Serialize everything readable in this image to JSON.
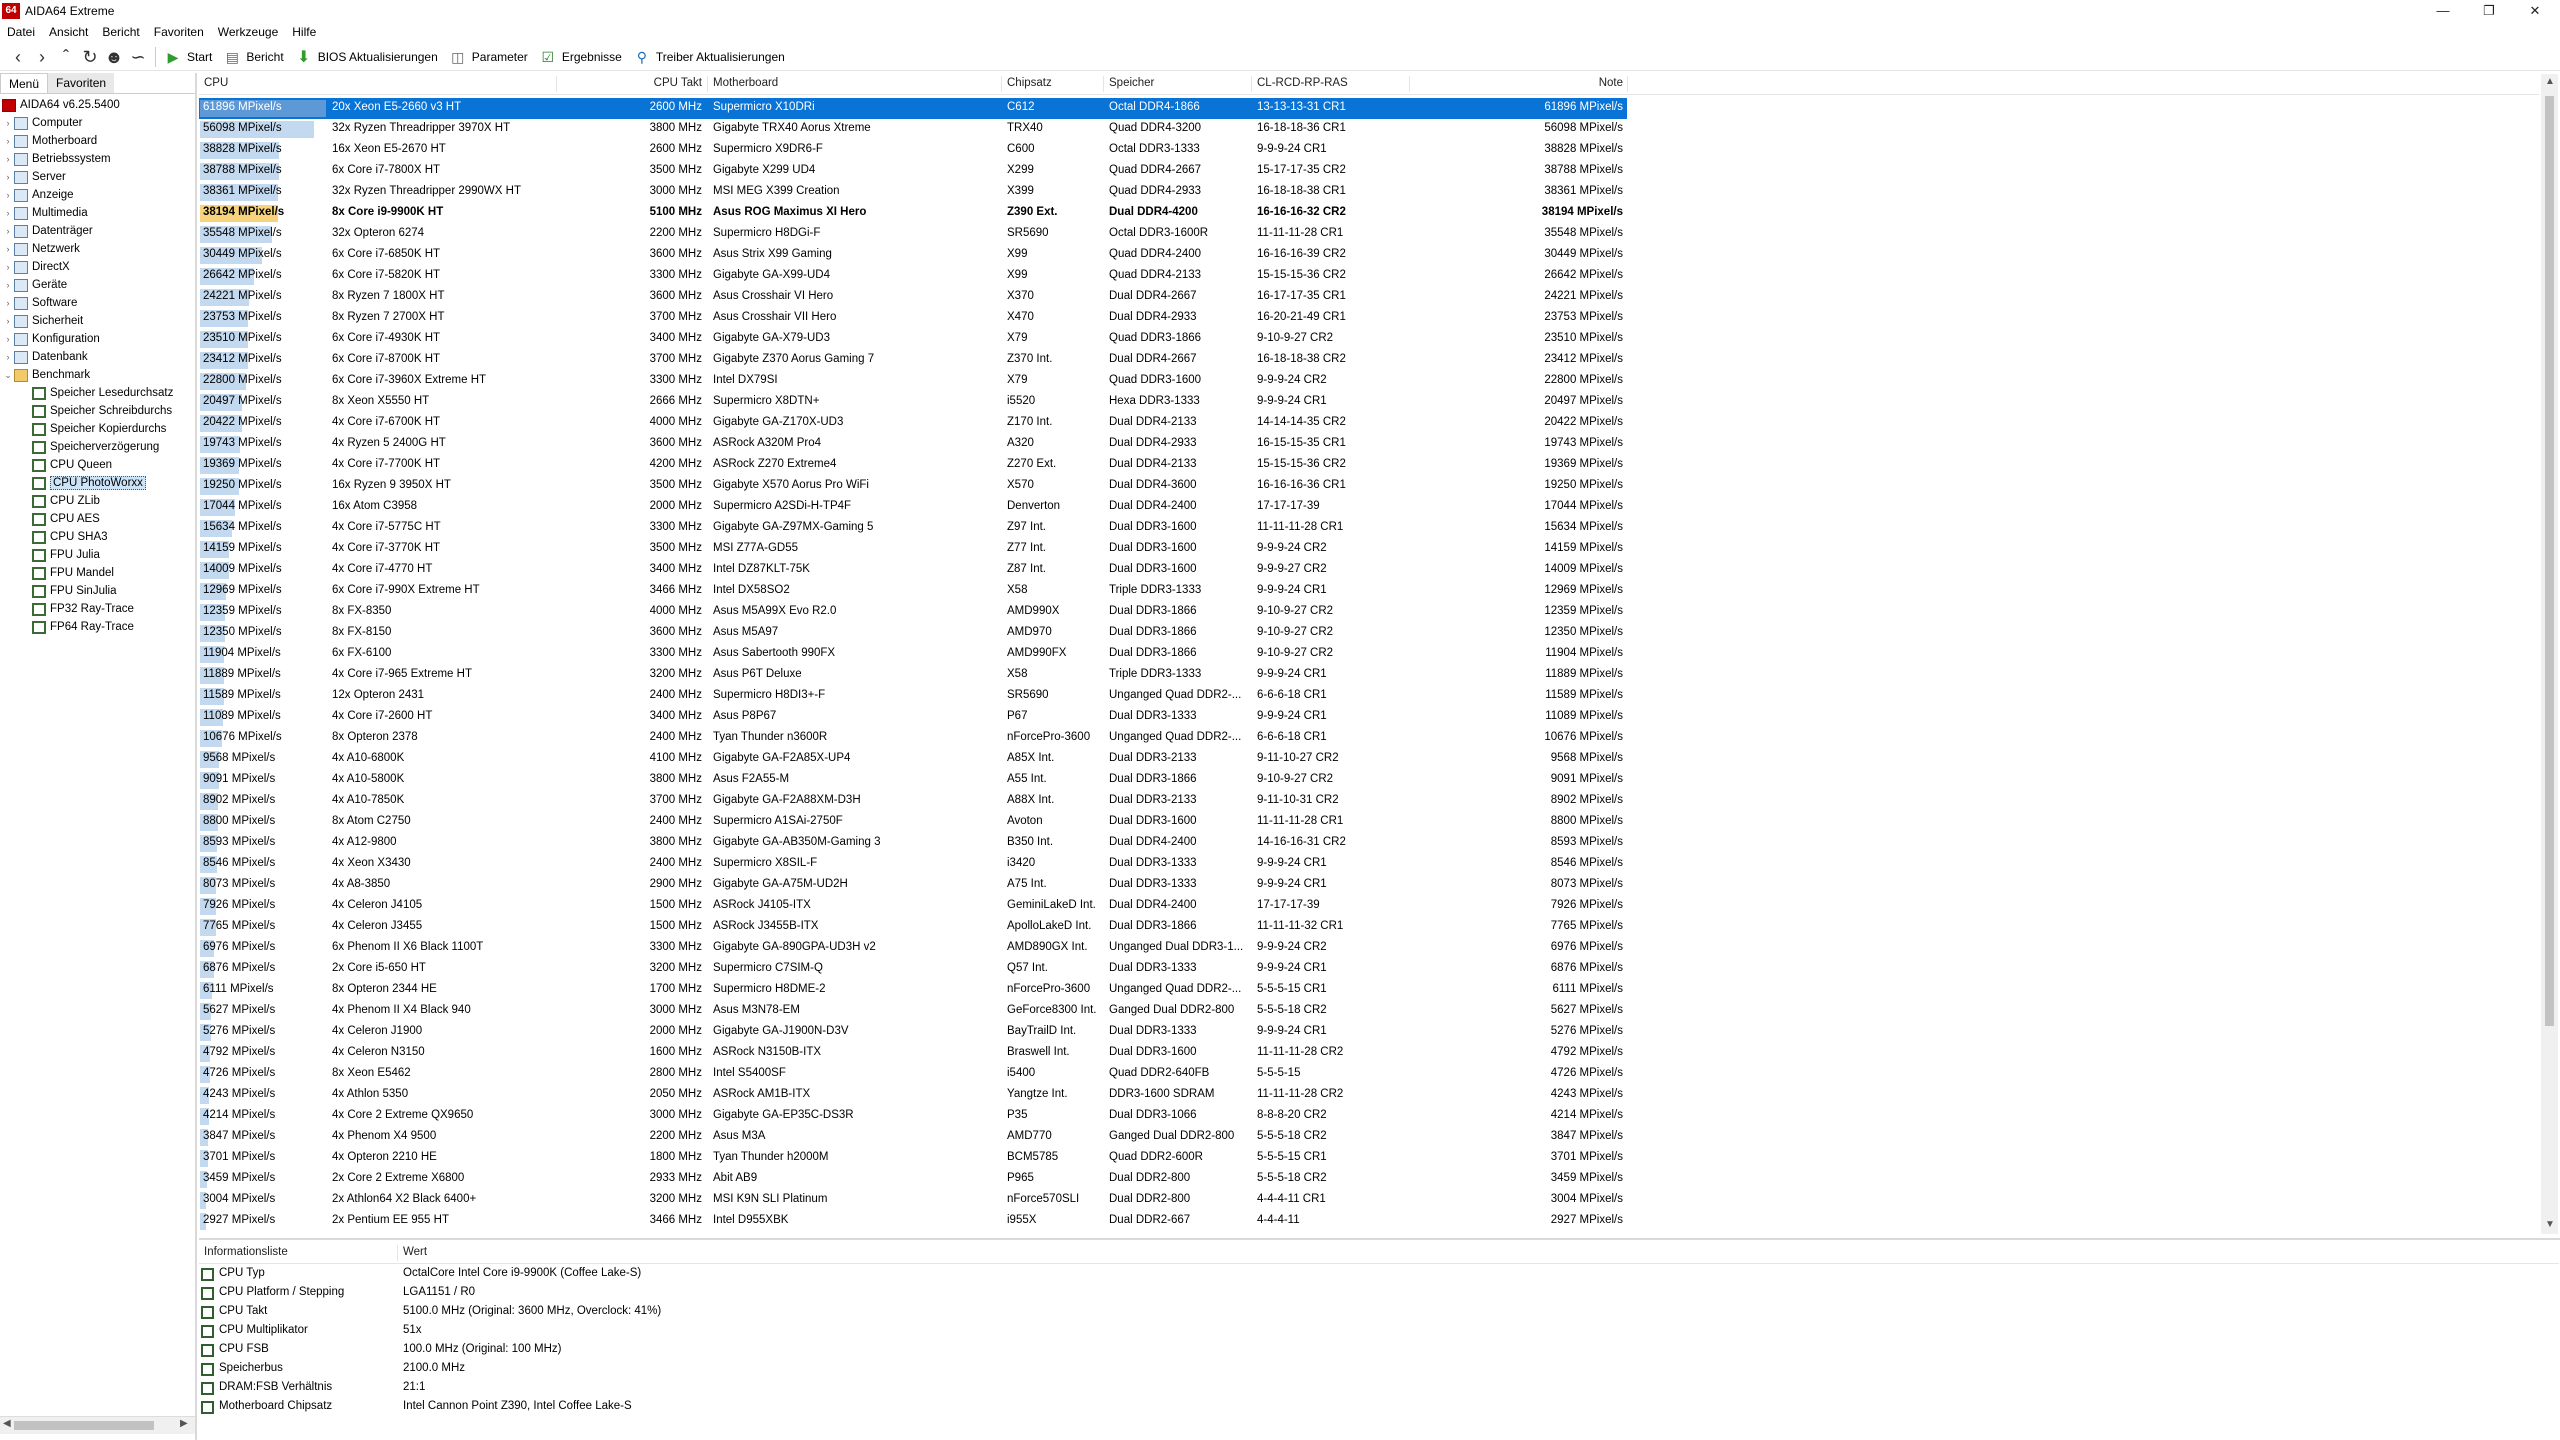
{
  "window": {
    "title": "AIDA64 Extreme",
    "icon_text": "64"
  },
  "menu": [
    "Datei",
    "Ansicht",
    "Bericht",
    "Favoriten",
    "Werkzeuge",
    "Hilfe"
  ],
  "toolbar": {
    "start": "Start",
    "bericht": "Bericht",
    "bios": "BIOS Aktualisierungen",
    "parameter": "Parameter",
    "ergebnisse": "Ergebnisse",
    "treiber": "Treiber Aktualisierungen"
  },
  "left_tabs": {
    "menu": "Menü",
    "favoriten": "Favoriten"
  },
  "tree": [
    {
      "label": "AIDA64 v6.25.5400",
      "level": 0,
      "kind": "root"
    },
    {
      "label": "Computer",
      "level": 1,
      "kind": "cat"
    },
    {
      "label": "Motherboard",
      "level": 1,
      "kind": "cat"
    },
    {
      "label": "Betriebssystem",
      "level": 1,
      "kind": "cat"
    },
    {
      "label": "Server",
      "level": 1,
      "kind": "cat"
    },
    {
      "label": "Anzeige",
      "level": 1,
      "kind": "cat"
    },
    {
      "label": "Multimedia",
      "level": 1,
      "kind": "cat"
    },
    {
      "label": "Datenträger",
      "level": 1,
      "kind": "cat"
    },
    {
      "label": "Netzwerk",
      "level": 1,
      "kind": "cat"
    },
    {
      "label": "DirectX",
      "level": 1,
      "kind": "cat"
    },
    {
      "label": "Geräte",
      "level": 1,
      "kind": "cat"
    },
    {
      "label": "Software",
      "level": 1,
      "kind": "cat"
    },
    {
      "label": "Sicherheit",
      "level": 1,
      "kind": "cat"
    },
    {
      "label": "Konfiguration",
      "level": 1,
      "kind": "cat"
    },
    {
      "label": "Datenbank",
      "level": 1,
      "kind": "cat"
    },
    {
      "label": "Benchmark",
      "level": 1,
      "kind": "folder",
      "expanded": true
    },
    {
      "label": "Speicher Lesedurchsatz",
      "level": 2,
      "kind": "bench"
    },
    {
      "label": "Speicher Schreibdurchs",
      "level": 2,
      "kind": "bench"
    },
    {
      "label": "Speicher Kopierdurchs",
      "level": 2,
      "kind": "bench"
    },
    {
      "label": "Speicherverzögerung",
      "level": 2,
      "kind": "bench"
    },
    {
      "label": "CPU Queen",
      "level": 2,
      "kind": "bench"
    },
    {
      "label": "CPU PhotoWorxx",
      "level": 2,
      "kind": "bench",
      "selected": true
    },
    {
      "label": "CPU ZLib",
      "level": 2,
      "kind": "bench"
    },
    {
      "label": "CPU AES",
      "level": 2,
      "kind": "bench"
    },
    {
      "label": "CPU SHA3",
      "level": 2,
      "kind": "bench"
    },
    {
      "label": "FPU Julia",
      "level": 2,
      "kind": "bench"
    },
    {
      "label": "FPU Mandel",
      "level": 2,
      "kind": "bench"
    },
    {
      "label": "FPU SinJulia",
      "level": 2,
      "kind": "bench"
    },
    {
      "label": "FP32 Ray-Trace",
      "level": 2,
      "kind": "bench"
    },
    {
      "label": "FP64 Ray-Trace",
      "level": 2,
      "kind": "bench"
    }
  ],
  "columns": {
    "cpu": "CPU",
    "clock": "CPU Takt",
    "motherboard": "Motherboard",
    "chipset": "Chipsatz",
    "memory": "Speicher",
    "timings": "CL-RCD-RP-RAS",
    "note": "Note"
  },
  "results_max": 61896,
  "results": [
    {
      "value": "61896 MPixel/s",
      "score": 61896,
      "cpu": "20x Xeon E5-2660 v3 HT",
      "clock": "2600 MHz",
      "mb": "Supermicro X10DRi",
      "chip": "C612",
      "mem": "Octal DDR4-1866",
      "tim": "13-13-13-31 CR1",
      "note": "61896 MPixel/s",
      "selected": true
    },
    {
      "value": "56098 MPixel/s",
      "score": 56098,
      "cpu": "32x Ryzen Threadripper 3970X HT",
      "clock": "3800 MHz",
      "mb": "Gigabyte TRX40 Aorus Xtreme",
      "chip": "TRX40",
      "mem": "Quad DDR4-3200",
      "tim": "16-18-18-36 CR1",
      "note": "56098 MPixel/s"
    },
    {
      "value": "38828 MPixel/s",
      "score": 38828,
      "cpu": "16x Xeon E5-2670 HT",
      "clock": "2600 MHz",
      "mb": "Supermicro X9DR6-F",
      "chip": "C600",
      "mem": "Octal DDR3-1333",
      "tim": "9-9-9-24 CR1",
      "note": "38828 MPixel/s"
    },
    {
      "value": "38788 MPixel/s",
      "score": 38788,
      "cpu": "6x Core i7-7800X HT",
      "clock": "3500 MHz",
      "mb": "Gigabyte X299 UD4",
      "chip": "X299",
      "mem": "Quad DDR4-2667",
      "tim": "15-17-17-35 CR2",
      "note": "38788 MPixel/s"
    },
    {
      "value": "38361 MPixel/s",
      "score": 38361,
      "cpu": "32x Ryzen Threadripper 2990WX HT",
      "clock": "3000 MHz",
      "mb": "MSI MEG X399 Creation",
      "chip": "X399",
      "mem": "Quad DDR4-2933",
      "tim": "16-18-18-38 CR1",
      "note": "38361 MPixel/s"
    },
    {
      "value": "38194 MPixel/s",
      "score": 38194,
      "cpu": "8x Core i9-9900K HT",
      "clock": "5100 MHz",
      "mb": "Asus ROG Maximus XI Hero",
      "chip": "Z390 Ext.",
      "mem": "Dual DDR4-4200",
      "tim": "16-16-16-32 CR2",
      "note": "38194 MPixel/s",
      "own": true
    },
    {
      "value": "35548 MPixel/s",
      "score": 35548,
      "cpu": "32x Opteron 6274",
      "clock": "2200 MHz",
      "mb": "Supermicro H8DGi-F",
      "chip": "SR5690",
      "mem": "Octal DDR3-1600R",
      "tim": "11-11-11-28 CR1",
      "note": "35548 MPixel/s"
    },
    {
      "value": "30449 MPixel/s",
      "score": 30449,
      "cpu": "6x Core i7-6850K HT",
      "clock": "3600 MHz",
      "mb": "Asus Strix X99 Gaming",
      "chip": "X99",
      "mem": "Quad DDR4-2400",
      "tim": "16-16-16-39 CR2",
      "note": "30449 MPixel/s"
    },
    {
      "value": "26642 MPixel/s",
      "score": 26642,
      "cpu": "6x Core i7-5820K HT",
      "clock": "3300 MHz",
      "mb": "Gigabyte GA-X99-UD4",
      "chip": "X99",
      "mem": "Quad DDR4-2133",
      "tim": "15-15-15-36 CR2",
      "note": "26642 MPixel/s"
    },
    {
      "value": "24221 MPixel/s",
      "score": 24221,
      "cpu": "8x Ryzen 7 1800X HT",
      "clock": "3600 MHz",
      "mb": "Asus Crosshair VI Hero",
      "chip": "X370",
      "mem": "Dual DDR4-2667",
      "tim": "16-17-17-35 CR1",
      "note": "24221 MPixel/s"
    },
    {
      "value": "23753 MPixel/s",
      "score": 23753,
      "cpu": "8x Ryzen 7 2700X HT",
      "clock": "3700 MHz",
      "mb": "Asus Crosshair VII Hero",
      "chip": "X470",
      "mem": "Dual DDR4-2933",
      "tim": "16-20-21-49 CR1",
      "note": "23753 MPixel/s"
    },
    {
      "value": "23510 MPixel/s",
      "score": 23510,
      "cpu": "6x Core i7-4930K HT",
      "clock": "3400 MHz",
      "mb": "Gigabyte GA-X79-UD3",
      "chip": "X79",
      "mem": "Quad DDR3-1866",
      "tim": "9-10-9-27 CR2",
      "note": "23510 MPixel/s"
    },
    {
      "value": "23412 MPixel/s",
      "score": 23412,
      "cpu": "6x Core i7-8700K HT",
      "clock": "3700 MHz",
      "mb": "Gigabyte Z370 Aorus Gaming 7",
      "chip": "Z370 Int.",
      "mem": "Dual DDR4-2667",
      "tim": "16-18-18-38 CR2",
      "note": "23412 MPixel/s"
    },
    {
      "value": "22800 MPixel/s",
      "score": 22800,
      "cpu": "6x Core i7-3960X Extreme HT",
      "clock": "3300 MHz",
      "mb": "Intel DX79SI",
      "chip": "X79",
      "mem": "Quad DDR3-1600",
      "tim": "9-9-9-24 CR2",
      "note": "22800 MPixel/s"
    },
    {
      "value": "20497 MPixel/s",
      "score": 20497,
      "cpu": "8x Xeon X5550 HT",
      "clock": "2666 MHz",
      "mb": "Supermicro X8DTN+",
      "chip": "i5520",
      "mem": "Hexa DDR3-1333",
      "tim": "9-9-9-24 CR1",
      "note": "20497 MPixel/s"
    },
    {
      "value": "20422 MPixel/s",
      "score": 20422,
      "cpu": "4x Core i7-6700K HT",
      "clock": "4000 MHz",
      "mb": "Gigabyte GA-Z170X-UD3",
      "chip": "Z170 Int.",
      "mem": "Dual DDR4-2133",
      "tim": "14-14-14-35 CR2",
      "note": "20422 MPixel/s"
    },
    {
      "value": "19743 MPixel/s",
      "score": 19743,
      "cpu": "4x Ryzen 5 2400G HT",
      "clock": "3600 MHz",
      "mb": "ASRock A320M Pro4",
      "chip": "A320",
      "mem": "Dual DDR4-2933",
      "tim": "16-15-15-35 CR1",
      "note": "19743 MPixel/s"
    },
    {
      "value": "19369 MPixel/s",
      "score": 19369,
      "cpu": "4x Core i7-7700K HT",
      "clock": "4200 MHz",
      "mb": "ASRock Z270 Extreme4",
      "chip": "Z270 Ext.",
      "mem": "Dual DDR4-2133",
      "tim": "15-15-15-36 CR2",
      "note": "19369 MPixel/s"
    },
    {
      "value": "19250 MPixel/s",
      "score": 19250,
      "cpu": "16x Ryzen 9 3950X HT",
      "clock": "3500 MHz",
      "mb": "Gigabyte X570 Aorus Pro WiFi",
      "chip": "X570",
      "mem": "Dual DDR4-3600",
      "tim": "16-16-16-36 CR1",
      "note": "19250 MPixel/s"
    },
    {
      "value": "17044 MPixel/s",
      "score": 17044,
      "cpu": "16x Atom C3958",
      "clock": "2000 MHz",
      "mb": "Supermicro A2SDi-H-TP4F",
      "chip": "Denverton",
      "mem": "Dual DDR4-2400",
      "tim": "17-17-17-39",
      "note": "17044 MPixel/s"
    },
    {
      "value": "15634 MPixel/s",
      "score": 15634,
      "cpu": "4x Core i7-5775C HT",
      "clock": "3300 MHz",
      "mb": "Gigabyte GA-Z97MX-Gaming 5",
      "chip": "Z97 Int.",
      "mem": "Dual DDR3-1600",
      "tim": "11-11-11-28 CR1",
      "note": "15634 MPixel/s"
    },
    {
      "value": "14159 MPixel/s",
      "score": 14159,
      "cpu": "4x Core i7-3770K HT",
      "clock": "3500 MHz",
      "mb": "MSI Z77A-GD55",
      "chip": "Z77 Int.",
      "mem": "Dual DDR3-1600",
      "tim": "9-9-9-24 CR2",
      "note": "14159 MPixel/s"
    },
    {
      "value": "14009 MPixel/s",
      "score": 14009,
      "cpu": "4x Core i7-4770 HT",
      "clock": "3400 MHz",
      "mb": "Intel DZ87KLT-75K",
      "chip": "Z87 Int.",
      "mem": "Dual DDR3-1600",
      "tim": "9-9-9-27 CR2",
      "note": "14009 MPixel/s"
    },
    {
      "value": "12969 MPixel/s",
      "score": 12969,
      "cpu": "6x Core i7-990X Extreme HT",
      "clock": "3466 MHz",
      "mb": "Intel DX58SO2",
      "chip": "X58",
      "mem": "Triple DDR3-1333",
      "tim": "9-9-9-24 CR1",
      "note": "12969 MPixel/s"
    },
    {
      "value": "12359 MPixel/s",
      "score": 12359,
      "cpu": "8x FX-8350",
      "clock": "4000 MHz",
      "mb": "Asus M5A99X Evo R2.0",
      "chip": "AMD990X",
      "mem": "Dual DDR3-1866",
      "tim": "9-10-9-27 CR2",
      "note": "12359 MPixel/s"
    },
    {
      "value": "12350 MPixel/s",
      "score": 12350,
      "cpu": "8x FX-8150",
      "clock": "3600 MHz",
      "mb": "Asus M5A97",
      "chip": "AMD970",
      "mem": "Dual DDR3-1866",
      "tim": "9-10-9-27 CR2",
      "note": "12350 MPixel/s"
    },
    {
      "value": "11904 MPixel/s",
      "score": 11904,
      "cpu": "6x FX-6100",
      "clock": "3300 MHz",
      "mb": "Asus Sabertooth 990FX",
      "chip": "AMD990FX",
      "mem": "Dual DDR3-1866",
      "tim": "9-10-9-27 CR2",
      "note": "11904 MPixel/s"
    },
    {
      "value": "11889 MPixel/s",
      "score": 11889,
      "cpu": "4x Core i7-965 Extreme HT",
      "clock": "3200 MHz",
      "mb": "Asus P6T Deluxe",
      "chip": "X58",
      "mem": "Triple DDR3-1333",
      "tim": "9-9-9-24 CR1",
      "note": "11889 MPixel/s"
    },
    {
      "value": "11589 MPixel/s",
      "score": 11589,
      "cpu": "12x Opteron 2431",
      "clock": "2400 MHz",
      "mb": "Supermicro H8DI3+-F",
      "chip": "SR5690",
      "mem": "Unganged Quad DDR2-...",
      "tim": "6-6-6-18 CR1",
      "note": "11589 MPixel/s"
    },
    {
      "value": "11089 MPixel/s",
      "score": 11089,
      "cpu": "4x Core i7-2600 HT",
      "clock": "3400 MHz",
      "mb": "Asus P8P67",
      "chip": "P67",
      "mem": "Dual DDR3-1333",
      "tim": "9-9-9-24 CR1",
      "note": "11089 MPixel/s"
    },
    {
      "value": "10676 MPixel/s",
      "score": 10676,
      "cpu": "8x Opteron 2378",
      "clock": "2400 MHz",
      "mb": "Tyan Thunder n3600R",
      "chip": "nForcePro-3600",
      "mem": "Unganged Quad DDR2-...",
      "tim": "6-6-6-18 CR1",
      "note": "10676 MPixel/s"
    },
    {
      "value": "9568 MPixel/s",
      "score": 9568,
      "cpu": "4x A10-6800K",
      "clock": "4100 MHz",
      "mb": "Gigabyte GA-F2A85X-UP4",
      "chip": "A85X Int.",
      "mem": "Dual DDR3-2133",
      "tim": "9-11-10-27 CR2",
      "note": "9568 MPixel/s"
    },
    {
      "value": "9091 MPixel/s",
      "score": 9091,
      "cpu": "4x A10-5800K",
      "clock": "3800 MHz",
      "mb": "Asus F2A55-M",
      "chip": "A55 Int.",
      "mem": "Dual DDR3-1866",
      "tim": "9-10-9-27 CR2",
      "note": "9091 MPixel/s"
    },
    {
      "value": "8902 MPixel/s",
      "score": 8902,
      "cpu": "4x A10-7850K",
      "clock": "3700 MHz",
      "mb": "Gigabyte GA-F2A88XM-D3H",
      "chip": "A88X Int.",
      "mem": "Dual DDR3-2133",
      "tim": "9-11-10-31 CR2",
      "note": "8902 MPixel/s"
    },
    {
      "value": "8800 MPixel/s",
      "score": 8800,
      "cpu": "8x Atom C2750",
      "clock": "2400 MHz",
      "mb": "Supermicro A1SAi-2750F",
      "chip": "Avoton",
      "mem": "Dual DDR3-1600",
      "tim": "11-11-11-28 CR1",
      "note": "8800 MPixel/s"
    },
    {
      "value": "8593 MPixel/s",
      "score": 8593,
      "cpu": "4x A12-9800",
      "clock": "3800 MHz",
      "mb": "Gigabyte GA-AB350M-Gaming 3",
      "chip": "B350 Int.",
      "mem": "Dual DDR4-2400",
      "tim": "14-16-16-31 CR2",
      "note": "8593 MPixel/s"
    },
    {
      "value": "8546 MPixel/s",
      "score": 8546,
      "cpu": "4x Xeon X3430",
      "clock": "2400 MHz",
      "mb": "Supermicro X8SIL-F",
      "chip": "i3420",
      "mem": "Dual DDR3-1333",
      "tim": "9-9-9-24 CR1",
      "note": "8546 MPixel/s"
    },
    {
      "value": "8073 MPixel/s",
      "score": 8073,
      "cpu": "4x A8-3850",
      "clock": "2900 MHz",
      "mb": "Gigabyte GA-A75M-UD2H",
      "chip": "A75 Int.",
      "mem": "Dual DDR3-1333",
      "tim": "9-9-9-24 CR1",
      "note": "8073 MPixel/s"
    },
    {
      "value": "7926 MPixel/s",
      "score": 7926,
      "cpu": "4x Celeron J4105",
      "clock": "1500 MHz",
      "mb": "ASRock J4105-ITX",
      "chip": "GeminiLakeD Int.",
      "mem": "Dual DDR4-2400",
      "tim": "17-17-17-39",
      "note": "7926 MPixel/s"
    },
    {
      "value": "7765 MPixel/s",
      "score": 7765,
      "cpu": "4x Celeron J3455",
      "clock": "1500 MHz",
      "mb": "ASRock J3455B-ITX",
      "chip": "ApolloLakeD Int.",
      "mem": "Dual DDR3-1866",
      "tim": "11-11-11-32 CR1",
      "note": "7765 MPixel/s"
    },
    {
      "value": "6976 MPixel/s",
      "score": 6976,
      "cpu": "6x Phenom II X6 Black 1100T",
      "clock": "3300 MHz",
      "mb": "Gigabyte GA-890GPA-UD3H v2",
      "chip": "AMD890GX Int.",
      "mem": "Unganged Dual DDR3-1...",
      "tim": "9-9-9-24 CR2",
      "note": "6976 MPixel/s"
    },
    {
      "value": "6876 MPixel/s",
      "score": 6876,
      "cpu": "2x Core i5-650 HT",
      "clock": "3200 MHz",
      "mb": "Supermicro C7SIM-Q",
      "chip": "Q57 Int.",
      "mem": "Dual DDR3-1333",
      "tim": "9-9-9-24 CR1",
      "note": "6876 MPixel/s"
    },
    {
      "value": "6111 MPixel/s",
      "score": 6111,
      "cpu": "8x Opteron 2344 HE",
      "clock": "1700 MHz",
      "mb": "Supermicro H8DME-2",
      "chip": "nForcePro-3600",
      "mem": "Unganged Quad DDR2-...",
      "tim": "5-5-5-15 CR1",
      "note": "6111 MPixel/s"
    },
    {
      "value": "5627 MPixel/s",
      "score": 5627,
      "cpu": "4x Phenom II X4 Black 940",
      "clock": "3000 MHz",
      "mb": "Asus M3N78-EM",
      "chip": "GeForce8300 Int.",
      "mem": "Ganged Dual DDR2-800",
      "tim": "5-5-5-18 CR2",
      "note": "5627 MPixel/s"
    },
    {
      "value": "5276 MPixel/s",
      "score": 5276,
      "cpu": "4x Celeron J1900",
      "clock": "2000 MHz",
      "mb": "Gigabyte GA-J1900N-D3V",
      "chip": "BayTrailD Int.",
      "mem": "Dual DDR3-1333",
      "tim": "9-9-9-24 CR1",
      "note": "5276 MPixel/s"
    },
    {
      "value": "4792 MPixel/s",
      "score": 4792,
      "cpu": "4x Celeron N3150",
      "clock": "1600 MHz",
      "mb": "ASRock N3150B-ITX",
      "chip": "Braswell Int.",
      "mem": "Dual DDR3-1600",
      "tim": "11-11-11-28 CR2",
      "note": "4792 MPixel/s"
    },
    {
      "value": "4726 MPixel/s",
      "score": 4726,
      "cpu": "8x Xeon E5462",
      "clock": "2800 MHz",
      "mb": "Intel S5400SF",
      "chip": "i5400",
      "mem": "Quad DDR2-640FB",
      "tim": "5-5-5-15",
      "note": "4726 MPixel/s"
    },
    {
      "value": "4243 MPixel/s",
      "score": 4243,
      "cpu": "4x Athlon 5350",
      "clock": "2050 MHz",
      "mb": "ASRock AM1B-ITX",
      "chip": "Yangtze Int.",
      "mem": "DDR3-1600 SDRAM",
      "tim": "11-11-11-28 CR2",
      "note": "4243 MPixel/s"
    },
    {
      "value": "4214 MPixel/s",
      "score": 4214,
      "cpu": "4x Core 2 Extreme QX9650",
      "clock": "3000 MHz",
      "mb": "Gigabyte GA-EP35C-DS3R",
      "chip": "P35",
      "mem": "Dual DDR3-1066",
      "tim": "8-8-8-20 CR2",
      "note": "4214 MPixel/s"
    },
    {
      "value": "3847 MPixel/s",
      "score": 3847,
      "cpu": "4x Phenom X4 9500",
      "clock": "2200 MHz",
      "mb": "Asus M3A",
      "chip": "AMD770",
      "mem": "Ganged Dual DDR2-800",
      "tim": "5-5-5-18 CR2",
      "note": "3847 MPixel/s"
    },
    {
      "value": "3701 MPixel/s",
      "score": 3701,
      "cpu": "4x Opteron 2210 HE",
      "clock": "1800 MHz",
      "mb": "Tyan Thunder h2000M",
      "chip": "BCM5785",
      "mem": "Quad DDR2-600R",
      "tim": "5-5-5-15 CR1",
      "note": "3701 MPixel/s"
    },
    {
      "value": "3459 MPixel/s",
      "score": 3459,
      "cpu": "2x Core 2 Extreme X6800",
      "clock": "2933 MHz",
      "mb": "Abit AB9",
      "chip": "P965",
      "mem": "Dual DDR2-800",
      "tim": "5-5-5-18 CR2",
      "note": "3459 MPixel/s"
    },
    {
      "value": "3004 MPixel/s",
      "score": 3004,
      "cpu": "2x Athlon64 X2 Black 6400+",
      "clock": "3200 MHz",
      "mb": "MSI K9N SLI Platinum",
      "chip": "nForce570SLI",
      "mem": "Dual DDR2-800",
      "tim": "4-4-4-11 CR1",
      "note": "3004 MPixel/s"
    },
    {
      "value": "2927 MPixel/s",
      "score": 2927,
      "cpu": "2x Pentium EE 955 HT",
      "clock": "3466 MHz",
      "mb": "Intel D955XBK",
      "chip": "i955X",
      "mem": "Dual DDR2-667",
      "tim": "4-4-4-11",
      "note": "2927 MPixel/s"
    }
  ],
  "info": {
    "header_label": "Informationsliste",
    "header_value": "Wert",
    "rows": [
      {
        "label": "CPU Typ",
        "value": "OctalCore Intel Core i9-9900K  (Coffee Lake-S)"
      },
      {
        "label": "CPU Platform / Stepping",
        "value": "LGA1151 / R0"
      },
      {
        "label": "CPU Takt",
        "value": "5100.0 MHz  (Original: 3600 MHz, Overclock: 41%)"
      },
      {
        "label": "CPU Multiplikator",
        "value": "51x"
      },
      {
        "label": "CPU FSB",
        "value": "100.0 MHz  (Original: 100 MHz)"
      },
      {
        "label": "Speicherbus",
        "value": "2100.0 MHz"
      },
      {
        "label": "DRAM:FSB Verhältnis",
        "value": "21:1"
      },
      {
        "label": "Motherboard Chipsatz",
        "value": "Intel Cannon Point Z390, Intel Coffee Lake-S"
      }
    ]
  },
  "colors": {
    "selection": "#0a74d6",
    "bar": "#c3d9ef",
    "own_bar": "#f6d37c",
    "brand": "#c00000"
  }
}
